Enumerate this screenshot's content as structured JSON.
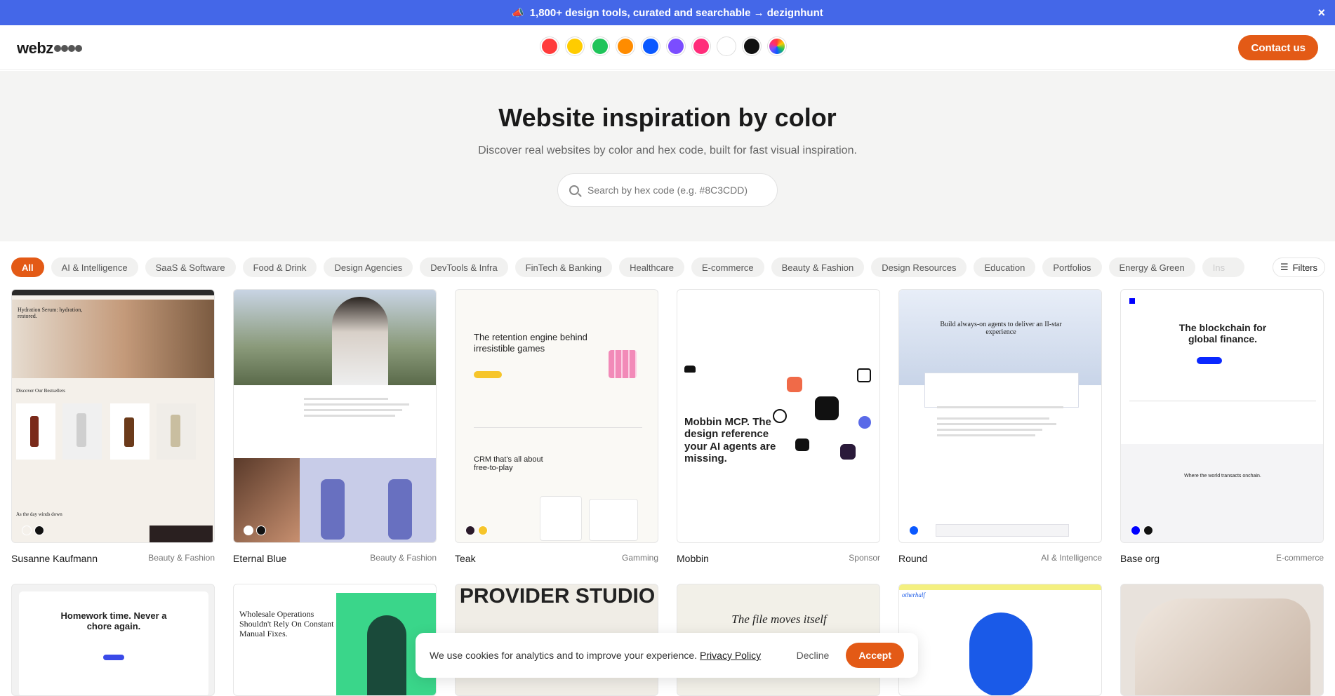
{
  "banner": {
    "text": "1,800+ design tools, curated and searchable → dezignhunt",
    "close": "×"
  },
  "logo": {
    "text": "webz"
  },
  "swatches": [
    "#ff3b3b",
    "#ffcc00",
    "#1fc45a",
    "#ff8c00",
    "#0a58ff",
    "#7b4dff",
    "#ff2d7a",
    "#ffffff",
    "#111111",
    "rainbow"
  ],
  "nav": {
    "contact_label": "Contact us"
  },
  "hero": {
    "title": "Website inspiration by color",
    "subtitle": "Discover real websites by color and hex code, built for fast visual inspiration.",
    "search_placeholder": "Search by hex code (e.g. #8C3CDD)"
  },
  "categories": [
    "All",
    "AI & Intelligence",
    "SaaS & Software",
    "Food & Drink",
    "Design Agencies",
    "DevTools & Infra",
    "FinTech & Banking",
    "Healthcare",
    "E-commerce",
    "Beauty & Fashion",
    "Design Resources",
    "Education",
    "Portfolios",
    "Energy & Green",
    "Ins"
  ],
  "filters_label": "Filters",
  "cards": [
    {
      "name": "Susanne Kaufmann",
      "category": "Beauty & Fashion",
      "headline": "Hydration Serum: hydration, restored.",
      "sub": "Discover Our Bestsellers",
      "foot": "As the day winds down"
    },
    {
      "name": "Eternal Blue",
      "category": "Beauty & Fashion"
    },
    {
      "name": "Teak",
      "category": "Gamming",
      "headline": "The retention engine behind irresistible games",
      "sub": "CRM that's all about free-to-play"
    },
    {
      "name": "Mobbin",
      "category": "Sponsor",
      "headline": "Mobbin MCP. The design reference your AI agents are missing."
    },
    {
      "name": "Round",
      "category": "AI & Intelligence",
      "headline": "Build always-on agents to deliver an II-star experience"
    },
    {
      "name": "Base org",
      "category": "E-commerce",
      "headline": "The blockchain for global finance.",
      "sub": "Where the world transacts onchain."
    }
  ],
  "row2": [
    {
      "headline": "Homework time. Never a chore again."
    },
    {
      "headline": "Wholesale Operations Shouldn't Rely On Constant Manual Fixes."
    },
    {
      "headline": "PROVIDER STUDIO"
    },
    {
      "headline": "The file moves itself"
    },
    {
      "headline": "otherhalf"
    },
    {
      "headline": ""
    }
  ],
  "cookie": {
    "text": "We use cookies for analytics and to improve your experience.",
    "link": "Privacy Policy",
    "decline": "Decline",
    "accept": "Accept"
  }
}
